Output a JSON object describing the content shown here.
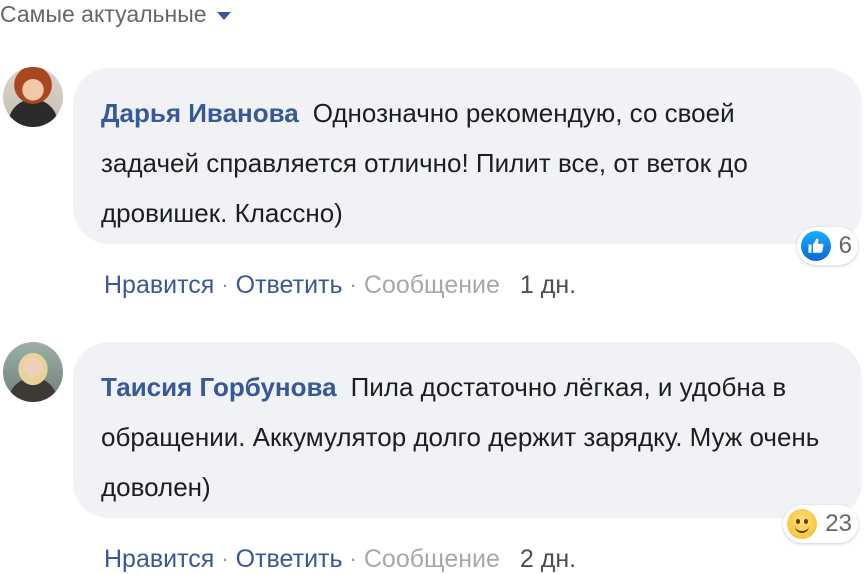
{
  "sort": {
    "label": "Самые актуальные"
  },
  "comments": [
    {
      "author": "Дарья Иванова",
      "text": "Однозначно рекомендую, со своей задачей справляется отлично! Пилит все, от веток до дровишек. Классно)",
      "reaction_icon": "like-icon",
      "reaction_count": "6",
      "actions": {
        "like": "Нравится",
        "reply": "Ответить",
        "message": "Сообщение",
        "separator": "·"
      },
      "time": "1 дн."
    },
    {
      "author": "Таисия Горбунова",
      "text": "Пила достаточно лёгкая, и удобна в обращении. Аккумулятор долго держит зарядку. Муж очень доволен)",
      "reaction_icon": "smile-icon",
      "reaction_count": "23",
      "actions": {
        "like": "Нравится",
        "reply": "Ответить",
        "message": "Сообщение",
        "separator": "·"
      },
      "time": "2 дн."
    }
  ],
  "colors": {
    "link": "#385898",
    "bubble": "#f0f2f5",
    "muted": "#a5a9ae"
  }
}
